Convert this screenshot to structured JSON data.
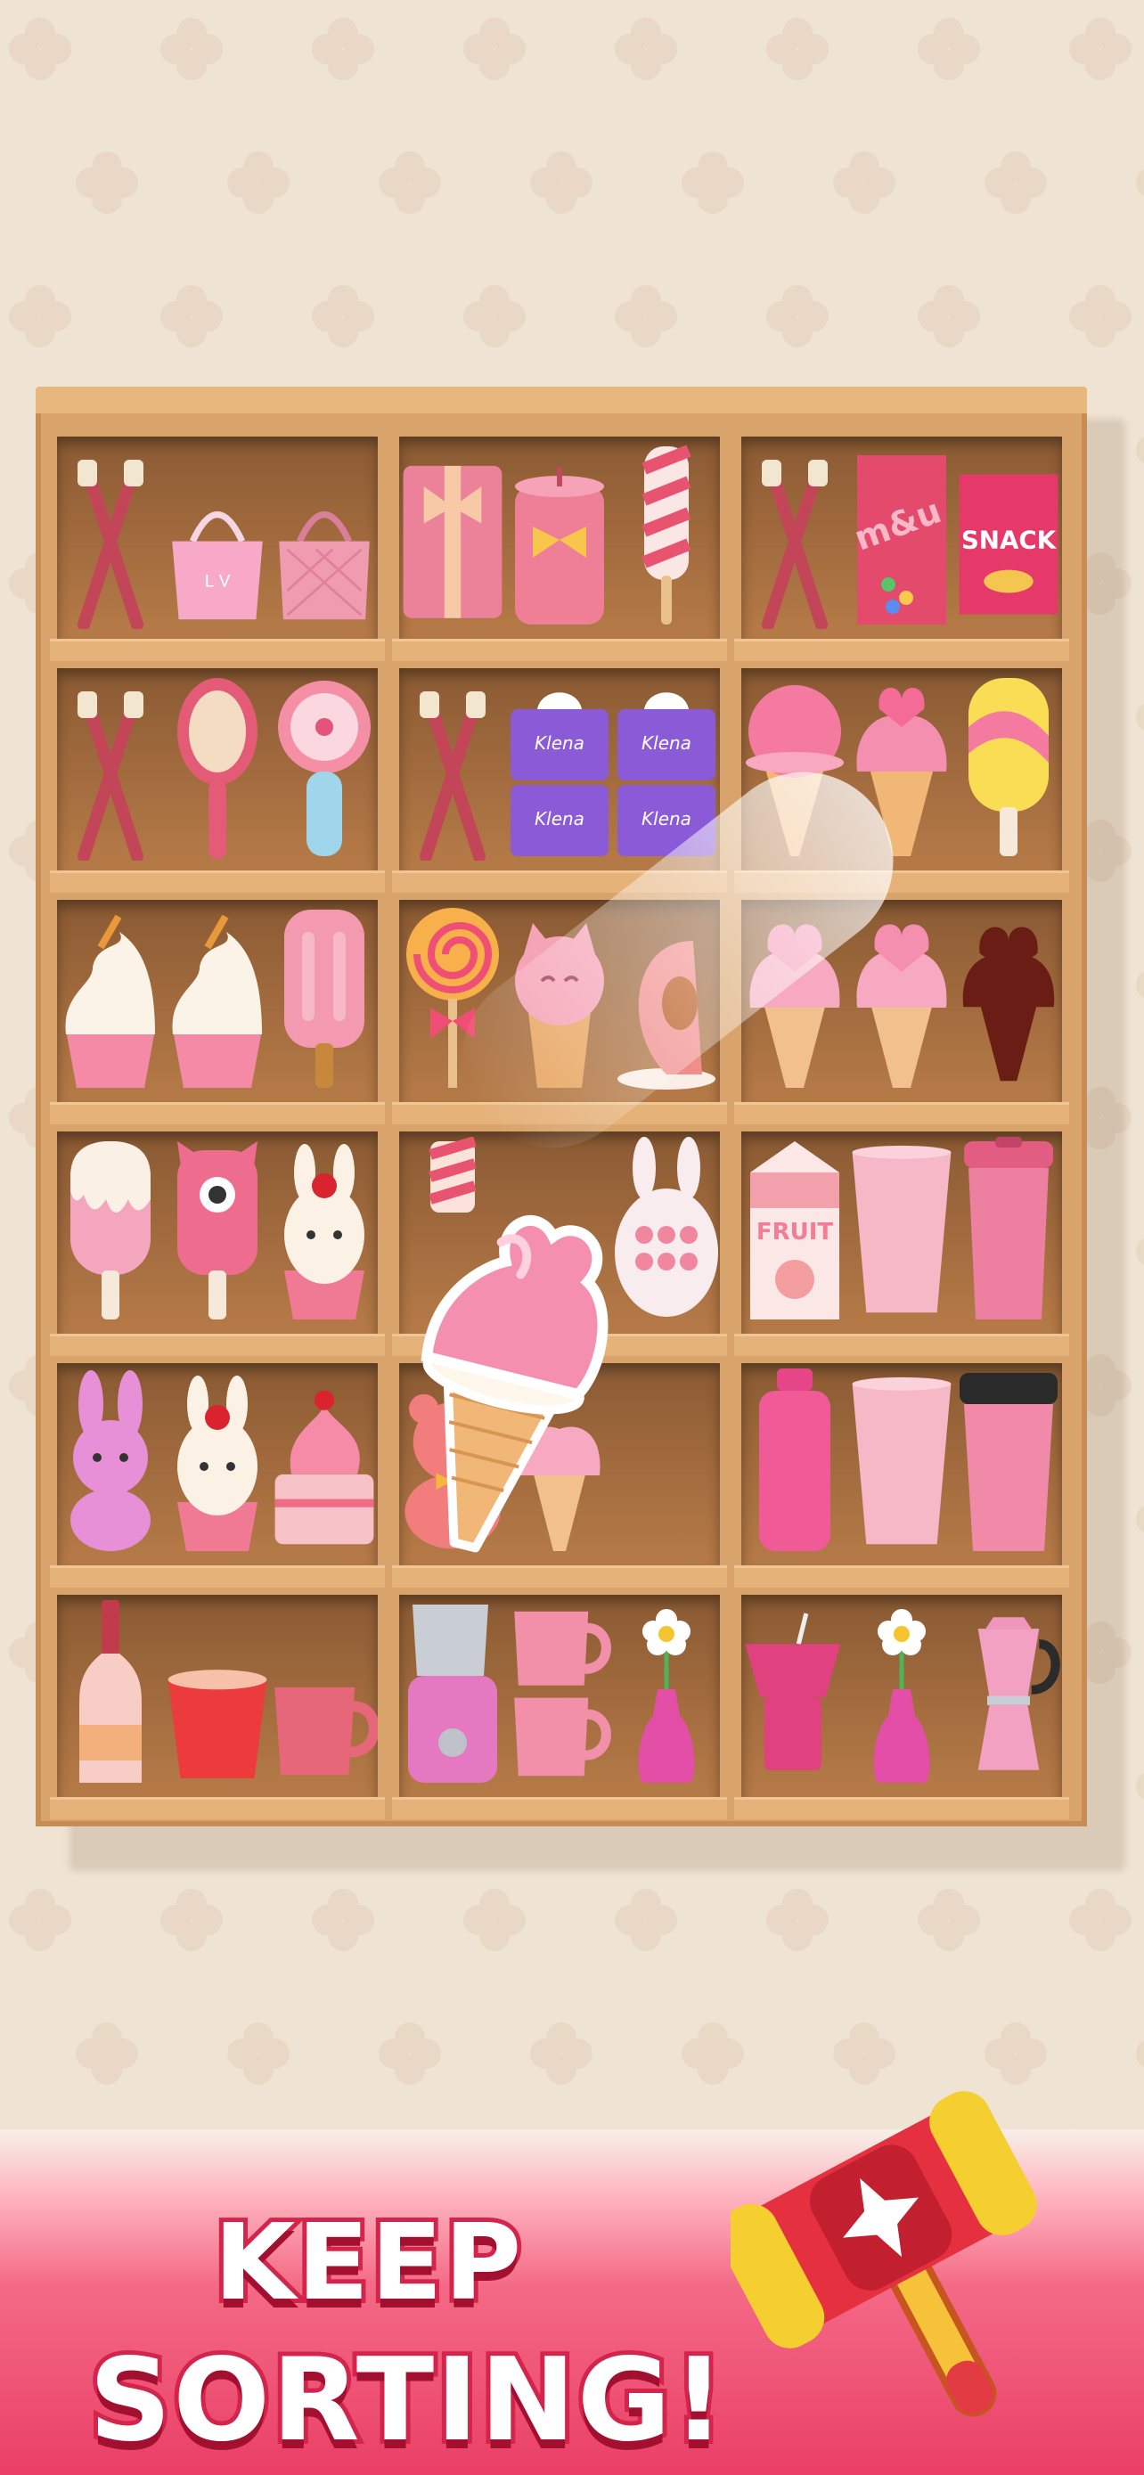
{
  "banner": {
    "line1": "KEEP",
    "line2": "SORTING!"
  },
  "items": {
    "row1": [
      "toothbrushes",
      "handbag-monogram",
      "handbag-quilted",
      "gift-box",
      "candle",
      "popsicle-twist",
      "toothbrushes",
      "chocolate-bag",
      "snack-bag"
    ],
    "row1_text": {
      "chocolate_bag": "m&u",
      "snack_bag": "SNACK"
    },
    "row2": [
      "toothbrushes",
      "hairbrush",
      "mini-fan",
      "toothbrushes",
      "tissue-box",
      "tissue-box",
      "ice-cream-cone",
      "ice-cream-cone-hearts",
      "popsicle-stripe"
    ],
    "row2_text": {
      "tissue": "Klena"
    },
    "row3": [
      "cupcake-swirl",
      "cupcake-swirl",
      "popsicle-pink",
      "lollipop",
      "cat-cone",
      "peach-slice",
      "heart-cone",
      "heart-cone",
      "empty-slot-silhouette"
    ],
    "row4": [
      "popsicle-drip",
      "popsicle-monster",
      "bunny-egg-cup",
      "candy-stick",
      "held-heart-cone",
      "bunny-popit",
      "fruit-milk",
      "tumbler-cup",
      "travel-tumbler"
    ],
    "row4_text": {
      "milk": "FRUIT"
    },
    "row5": [
      "bunny-plush",
      "bunny-egg-cup",
      "layer-cake",
      "teddy-bear",
      "heart-cone-small",
      "water-bottle",
      "tumbler-cup",
      "coffee-cup-lid"
    ],
    "row6": [
      "wine-bottle",
      "jelly-pudding",
      "mug",
      "blender",
      "stacked-mugs",
      "flower-vase",
      "straw-cup",
      "flower-vase",
      "moka-pot"
    ]
  },
  "colors": {
    "background": "#efe3d3",
    "shelf_wood": "#d9a46b",
    "cell_inner": "#a66e40",
    "accent_pink": "#f47c9d",
    "banner_red": "#ea3f67"
  }
}
